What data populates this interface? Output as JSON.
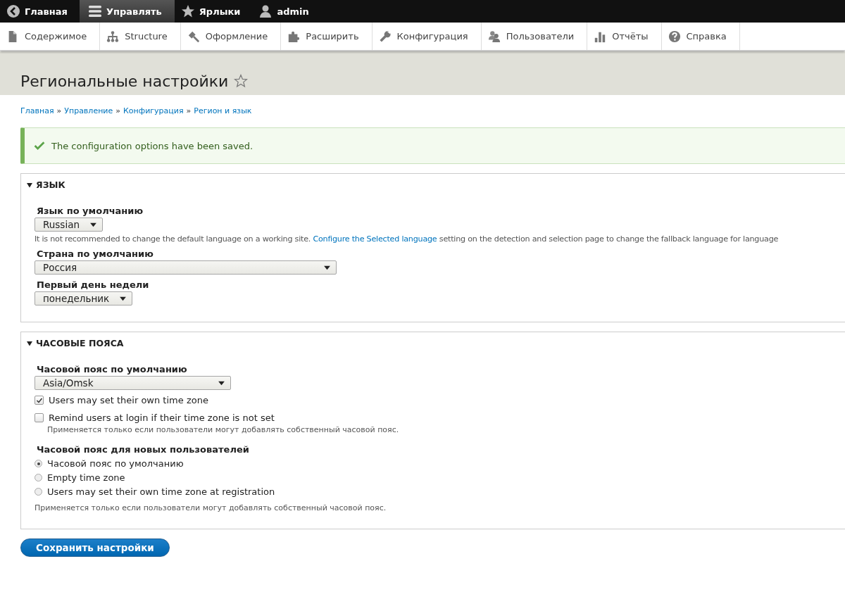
{
  "toolbar": [
    {
      "label": "Главная",
      "selected": false
    },
    {
      "label": "Управлять",
      "selected": true
    },
    {
      "label": "Ярлыки",
      "selected": false
    },
    {
      "label": "admin",
      "selected": false
    }
  ],
  "tray": [
    "Содержимое",
    "Structure",
    "Оформление",
    "Расширить",
    "Конфигурация",
    "Пользователи",
    "Отчёты",
    "Справка"
  ],
  "page_title": "Региональные настройки",
  "breadcrumb": [
    "Главная",
    "Управление",
    "Конфигурация",
    "Регион и язык"
  ],
  "breadcrumb_separator": "»",
  "message": "The configuration options have been saved.",
  "sections": [
    {
      "title": "ЯЗЫК",
      "expanded": true,
      "items": [
        {
          "kind": "select",
          "label": "Язык по умолчанию",
          "value": "Russian",
          "description": {
            "before": "It is not recommended to change the default language on a working site.",
            "link": "Configure the Selected language",
            "after": "setting on the detection and selection page to change the fallback language for language"
          }
        },
        {
          "kind": "select",
          "label": "Страна по умолчанию",
          "value": "Россия"
        },
        {
          "kind": "select",
          "label": "Первый день недели",
          "value": "понедельник"
        }
      ]
    },
    {
      "title": "ЧАСОВЫЕ ПОЯСА",
      "expanded": true,
      "items": [
        {
          "kind": "select",
          "label": "Часовой пояс по умолчанию",
          "value": "Asia/Omsk"
        },
        {
          "kind": "checkbox",
          "label": "Users may set their own time zone",
          "checked": true
        },
        {
          "kind": "checkbox",
          "label": "Remind users at login if their time zone is not set",
          "checked": false,
          "note": "Применяется только если пользователи могут добавлять собственный часовой пояс."
        },
        {
          "kind": "radios",
          "label": "Часовой пояс для новых пользователей",
          "options": [
            {
              "label": "Часовой пояс по умолчанию",
              "selected": true
            },
            {
              "label": "Empty time zone",
              "selected": false
            },
            {
              "label": "Users may set their own time zone at registration",
              "selected": false
            }
          ],
          "note": "Применяется только если пользователи могут добавлять собственный часовой пояс."
        }
      ]
    }
  ],
  "submit": "Сохранить настройки"
}
